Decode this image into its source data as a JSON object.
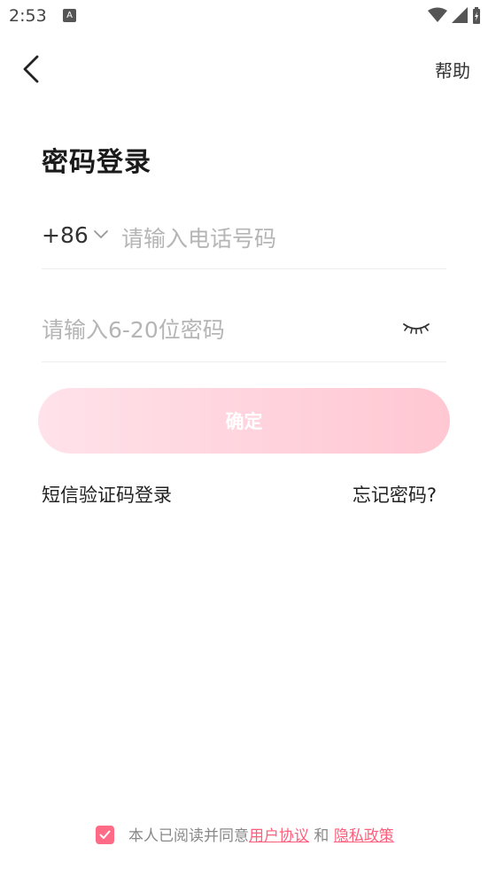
{
  "status_bar": {
    "time": "2:53",
    "app_icon": "A"
  },
  "nav": {
    "back_icon": "chevron-left-icon",
    "help_label": "帮助"
  },
  "page": {
    "title": "密码登录"
  },
  "phone": {
    "country_code": "+86",
    "placeholder": "请输入电话号码",
    "value": ""
  },
  "password": {
    "placeholder": "请输入6-20位密码",
    "value": "",
    "toggle_icon": "eye-closed-icon"
  },
  "actions": {
    "confirm_label": "确定",
    "sms_login_label": "短信验证码登录",
    "forgot_label": "忘记密码?"
  },
  "agreement": {
    "checked": true,
    "text": "本人已阅读并同意",
    "user_agreement": "用户协议",
    "and": "和",
    "privacy_policy": "隐私政策"
  },
  "colors": {
    "accent": "#ff6b86",
    "button_gradient_start": "#ffe2ea",
    "button_gradient_end": "#ffc7d2",
    "link": "#ff5e7a"
  }
}
